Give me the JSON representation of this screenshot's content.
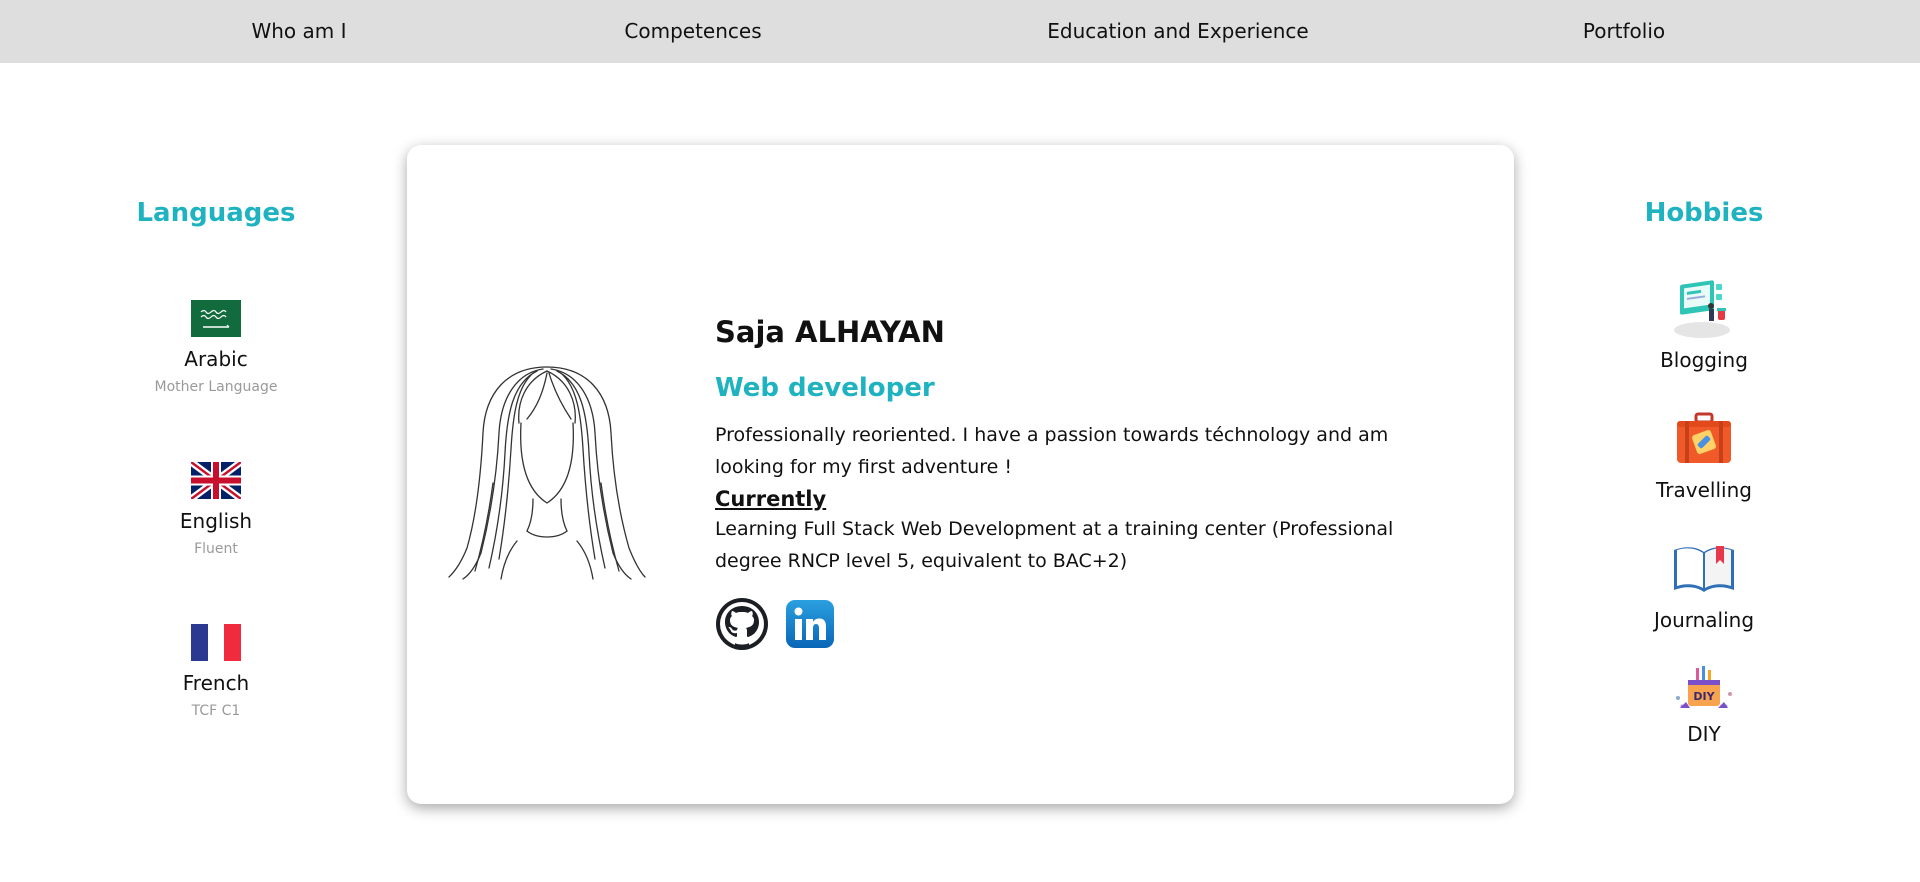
{
  "nav": {
    "items": [
      {
        "label": "Who am I"
      },
      {
        "label": "Competences"
      },
      {
        "label": "Education and Experience"
      },
      {
        "label": "Portfolio"
      }
    ]
  },
  "languages": {
    "title": "Languages",
    "items": [
      {
        "name": "Arabic",
        "level": "Mother Language",
        "flag_icon": "saudi-flag-icon"
      },
      {
        "name": "English",
        "level": "Fluent",
        "flag_icon": "uk-flag-icon"
      },
      {
        "name": "French",
        "level": "TCF C1",
        "flag_icon": "france-flag-icon"
      }
    ]
  },
  "hobbies": {
    "title": "Hobbies",
    "items": [
      {
        "name": "Blogging",
        "icon": "blogging-icon"
      },
      {
        "name": "Travelling",
        "icon": "suitcase-icon"
      },
      {
        "name": "Journaling",
        "icon": "book-icon"
      },
      {
        "name": "DIY",
        "icon": "diy-icon"
      }
    ]
  },
  "profile": {
    "name": "Saja ALHAYAN",
    "role": "Web developer",
    "bio": "Professionally reoriented. I have a passion towards téchnology and am looking for my first adventure !",
    "currently_heading": "Currently",
    "currently_text": "Learning Full Stack Web Development at a training center (Professional degree RNCP level 5, equivalent to BAC+2)",
    "social_icons": [
      "github-icon",
      "linkedin-icon"
    ]
  },
  "colors": {
    "accent": "#1fb3c1",
    "nav_background": "#dedede",
    "muted_text": "#9a9a9a"
  }
}
